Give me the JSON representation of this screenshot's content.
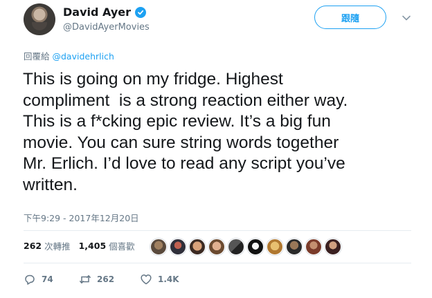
{
  "user": {
    "display_name": "David Ayer",
    "handle": "@DavidAyerMovies",
    "verified": true
  },
  "follow_button_label": "跟隨",
  "reply_context": {
    "prefix": "回覆給",
    "mention": "@davidehrlich"
  },
  "tweet": {
    "text": "This is going on my fridge. Highest\ncompliment  is a strong reaction either way.\nThis is a f*cking epic review. It’s a big fun\nmovie. You can sure string words together\nMr. Erlich. I’d love to read any script you’ve\nwritten.",
    "timestamp": "下午9:29 - 2017年12月20日"
  },
  "stats": {
    "retweets": "262",
    "retweets_label": "次轉推",
    "likes": "1,405",
    "likes_label": "個喜歡"
  },
  "actions": {
    "reply_count": "74",
    "retweet_count": "262",
    "like_count": "1.4K"
  },
  "colors": {
    "accent": "#1da1f2",
    "secondary_text": "#657786",
    "primary_text": "#14171a",
    "divider": "#e6ecf0"
  }
}
